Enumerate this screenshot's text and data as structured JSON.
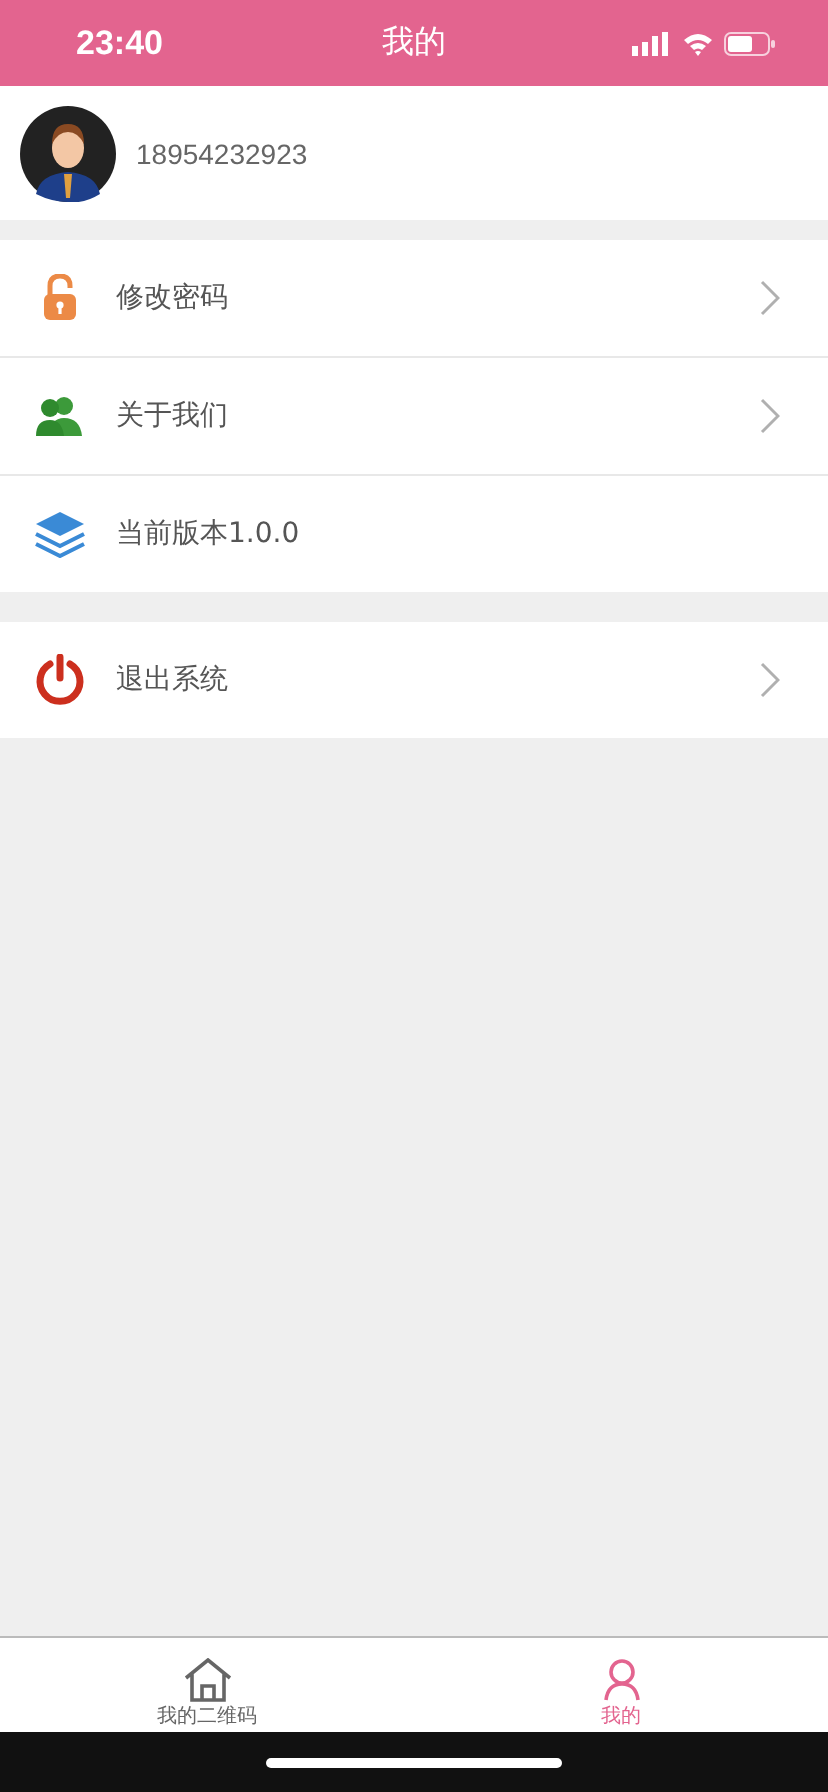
{
  "status_bar": {
    "time": "23:40"
  },
  "header": {
    "title": "我的"
  },
  "profile": {
    "phone": "18954232923"
  },
  "menu_groups": [
    {
      "items": [
        {
          "kind": "lock",
          "label": "修改密码",
          "chevron": true
        },
        {
          "kind": "people",
          "label": "关于我们",
          "chevron": true
        },
        {
          "kind": "layers",
          "label": "当前版本1.0.0",
          "chevron": false
        }
      ]
    },
    {
      "items": [
        {
          "kind": "power",
          "label": "退出系统",
          "chevron": true
        }
      ]
    }
  ],
  "tabs": [
    {
      "kind": "home",
      "label": "我的二维码",
      "selected": false
    },
    {
      "kind": "person",
      "label": "我的",
      "selected": true
    }
  ]
}
